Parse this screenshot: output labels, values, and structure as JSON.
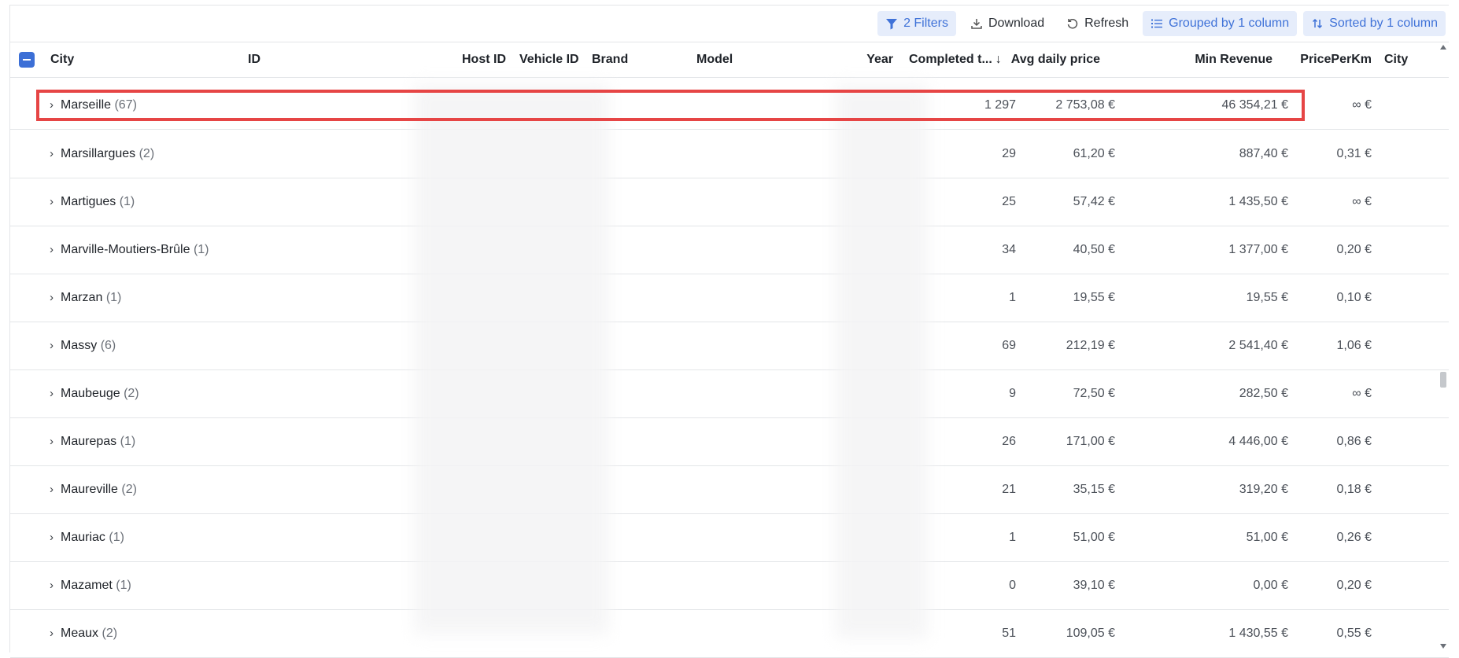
{
  "toolbar": {
    "filters_label": "2 Filters",
    "download_label": "Download",
    "refresh_label": "Refresh",
    "grouped_label": "Grouped by 1 column",
    "sorted_label": "Sorted by 1 column"
  },
  "columns": {
    "city": "City",
    "id": "ID",
    "host_id": "Host ID",
    "vehicle_id": "Vehicle ID",
    "brand": "Brand",
    "model": "Model",
    "year": "Year",
    "completed": "Completed t...",
    "avg_daily_price": "Avg daily price",
    "min_revenue": "Min Revenue",
    "price_per_km": "PricePerKm",
    "city2": "City"
  },
  "rows": [
    {
      "city": "Marseille",
      "count": "(67)",
      "completed": "1 297",
      "avg": "2 753,08 €",
      "min_revenue": "46 354,21 €",
      "ppk": "∞ €"
    },
    {
      "city": "Marsillargues",
      "count": "(2)",
      "completed": "29",
      "avg": "61,20 €",
      "min_revenue": "887,40 €",
      "ppk": "0,31 €"
    },
    {
      "city": "Martigues",
      "count": "(1)",
      "completed": "25",
      "avg": "57,42 €",
      "min_revenue": "1 435,50 €",
      "ppk": "∞ €"
    },
    {
      "city": "Marville-Moutiers-Brûle",
      "count": "(1)",
      "completed": "34",
      "avg": "40,50 €",
      "min_revenue": "1 377,00 €",
      "ppk": "0,20 €"
    },
    {
      "city": "Marzan",
      "count": "(1)",
      "completed": "1",
      "avg": "19,55 €",
      "min_revenue": "19,55 €",
      "ppk": "0,10 €"
    },
    {
      "city": "Massy",
      "count": "(6)",
      "completed": "69",
      "avg": "212,19 €",
      "min_revenue": "2 541,40 €",
      "ppk": "1,06 €"
    },
    {
      "city": "Maubeuge",
      "count": "(2)",
      "completed": "9",
      "avg": "72,50 €",
      "min_revenue": "282,50 €",
      "ppk": "∞ €"
    },
    {
      "city": "Maurepas",
      "count": "(1)",
      "completed": "26",
      "avg": "171,00 €",
      "min_revenue": "4 446,00 €",
      "ppk": "0,86 €"
    },
    {
      "city": "Maureville",
      "count": "(2)",
      "completed": "21",
      "avg": "35,15 €",
      "min_revenue": "319,20 €",
      "ppk": "0,18 €"
    },
    {
      "city": "Mauriac",
      "count": "(1)",
      "completed": "1",
      "avg": "51,00 €",
      "min_revenue": "51,00 €",
      "ppk": "0,26 €"
    },
    {
      "city": "Mazamet",
      "count": "(1)",
      "completed": "0",
      "avg": "39,10 €",
      "min_revenue": "0,00 €",
      "ppk": "0,20 €"
    },
    {
      "city": "Meaux",
      "count": "(2)",
      "completed": "51",
      "avg": "109,05 €",
      "min_revenue": "1 430,55 €",
      "ppk": "0,55 €"
    }
  ],
  "colors": {
    "accent": "#3c6fd6",
    "active_bg": "#e6edfb",
    "highlight_border": "#e64545"
  }
}
